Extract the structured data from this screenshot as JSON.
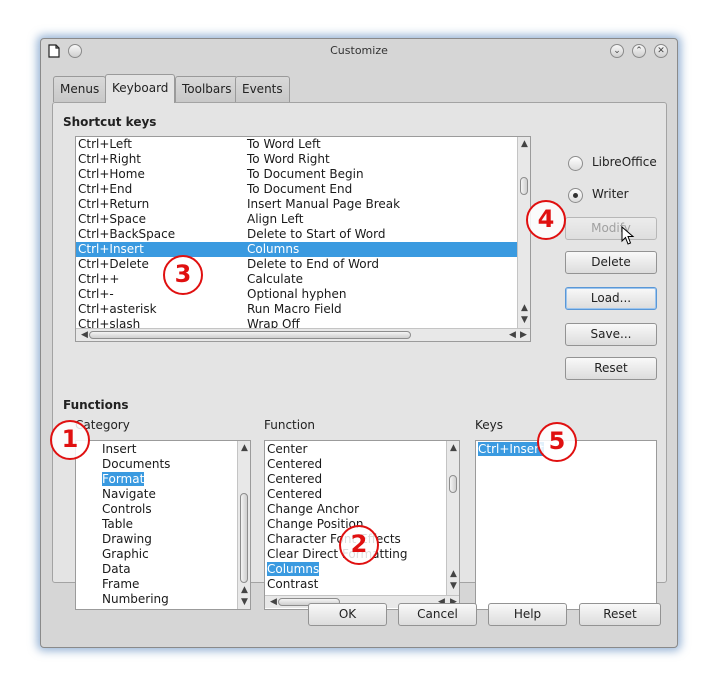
{
  "window": {
    "title": "Customize"
  },
  "tabs": [
    "Menus",
    "Keyboard",
    "Toolbars",
    "Events"
  ],
  "shortcut_keys": {
    "title": "Shortcut keys",
    "rows": [
      {
        "key": "Ctrl+Left",
        "function": "To Word Left"
      },
      {
        "key": "Ctrl+Right",
        "function": "To Word Right"
      },
      {
        "key": "Ctrl+Home",
        "function": "To Document Begin"
      },
      {
        "key": "Ctrl+End",
        "function": "To Document End"
      },
      {
        "key": "Ctrl+Return",
        "function": "Insert Manual Page Break"
      },
      {
        "key": "Ctrl+Space",
        "function": "Align Left"
      },
      {
        "key": "Ctrl+BackSpace",
        "function": "Delete to Start of Word"
      },
      {
        "key": "Ctrl+Insert",
        "function": "Columns"
      },
      {
        "key": "Ctrl+Delete",
        "function": "Delete to End of Word"
      },
      {
        "key": "Ctrl++",
        "function": "Calculate"
      },
      {
        "key": "Ctrl+-",
        "function": "Optional hyphen"
      },
      {
        "key": "Ctrl+asterisk",
        "function": "Run Macro Field"
      },
      {
        "key": "Ctrl+slash",
        "function": "Wrap Off"
      }
    ],
    "selected_index": 7
  },
  "scope_options": [
    {
      "label": "LibreOffice",
      "checked": false
    },
    {
      "label": "Writer",
      "checked": true
    }
  ],
  "side_buttons": {
    "modify": "Modify",
    "delete": "Delete",
    "load": "Load...",
    "save": "Save...",
    "reset": "Reset"
  },
  "functions": {
    "title": "Functions",
    "category_label": "Category",
    "function_label": "Function",
    "keys_label": "Keys",
    "categories": [
      "Insert",
      "Documents",
      "Format",
      "Navigate",
      "Controls",
      "Table",
      "Drawing",
      "Graphic",
      "Data",
      "Frame",
      "Numbering"
    ],
    "selected_category": 2,
    "function_items": [
      "Center",
      "Centered",
      "Centered",
      "Centered",
      "Change Anchor",
      "Change Position",
      "Character Font Effects",
      "Clear Direct Formatting",
      "Columns",
      "Contrast"
    ],
    "selected_function": 8,
    "keys": [
      "Ctrl+Insert"
    ]
  },
  "bottom_buttons": {
    "ok": "OK",
    "cancel": "Cancel",
    "help": "Help",
    "reset": "Reset"
  },
  "markers": [
    "1",
    "2",
    "3",
    "4",
    "5"
  ],
  "colors": {
    "selection": "#3a9ae0",
    "marker": "#e01010"
  }
}
